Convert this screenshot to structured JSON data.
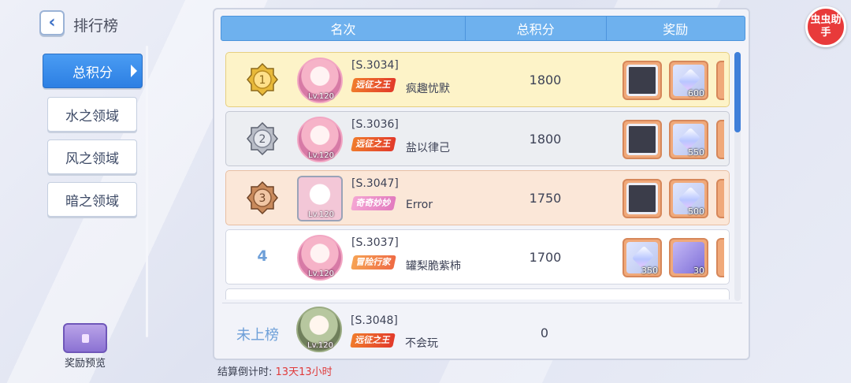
{
  "header": {
    "title": "排行榜"
  },
  "sidebar": {
    "tabs": [
      {
        "label": "总积分",
        "active": true
      },
      {
        "label": "水之领域",
        "active": false
      },
      {
        "label": "风之领域",
        "active": false
      },
      {
        "label": "暗之领域",
        "active": false
      }
    ],
    "reward_preview_label": "奖励预览"
  },
  "table": {
    "columns": [
      "名次",
      "总积分",
      "奖励"
    ],
    "rows": [
      {
        "rank": "1",
        "level": "Lv.120",
        "server": "[S.3034]",
        "title": "远征之王",
        "name": "疯趣忧默",
        "score": "1800",
        "rewards": [
          "",
          "600",
          ""
        ]
      },
      {
        "rank": "2",
        "level": "Lv.120",
        "server": "[S.3036]",
        "title": "远征之王",
        "name": "盐以律己",
        "score": "1800",
        "rewards": [
          "",
          "550",
          ""
        ]
      },
      {
        "rank": "3",
        "level": "Lv.120",
        "server": "[S.3047]",
        "title": "奇奇妙妙",
        "name": "Error",
        "score": "1750",
        "rewards": [
          "",
          "500",
          ""
        ]
      },
      {
        "rank": "4",
        "level": "Lv.120",
        "server": "[S.3037]",
        "title": "冒险行家",
        "name": "罐梨脆紫柿",
        "score": "1700",
        "rewards": [
          "350",
          "30",
          ""
        ]
      }
    ]
  },
  "self": {
    "rank": "未上榜",
    "level": "Lv.120",
    "server": "[S.3048]",
    "title": "远征之王",
    "name": "不会玩",
    "score": "0"
  },
  "footer": {
    "countdown_label": "结算倒计时:",
    "countdown_value": "13天13小时"
  },
  "logo": {
    "text": "虫虫助手"
  }
}
